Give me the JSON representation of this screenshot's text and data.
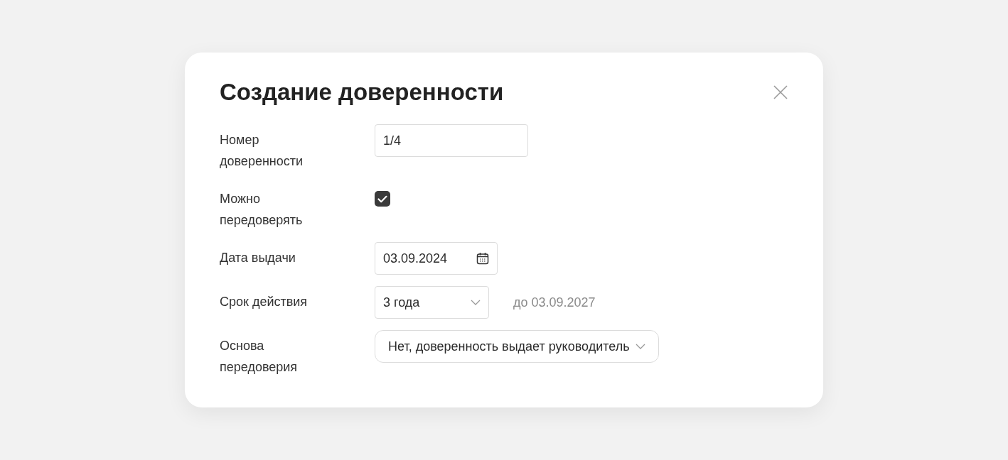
{
  "dialog": {
    "title": "Создание доверенности",
    "fields": [
      {
        "kind": "text",
        "label": "Номер доверенности",
        "value": "1/4"
      },
      {
        "kind": "checkbox",
        "label": "Можно передоверять",
        "checked": true
      },
      {
        "kind": "date",
        "label": "Дата выдачи",
        "value": "03.09.2024"
      },
      {
        "kind": "select",
        "label": "Срок действия",
        "value": "3 года",
        "note": "до 03.09.2027"
      },
      {
        "kind": "pill-select",
        "label": "Основа передоверия",
        "value": "Нет, доверенность выдает руководитель"
      }
    ]
  }
}
